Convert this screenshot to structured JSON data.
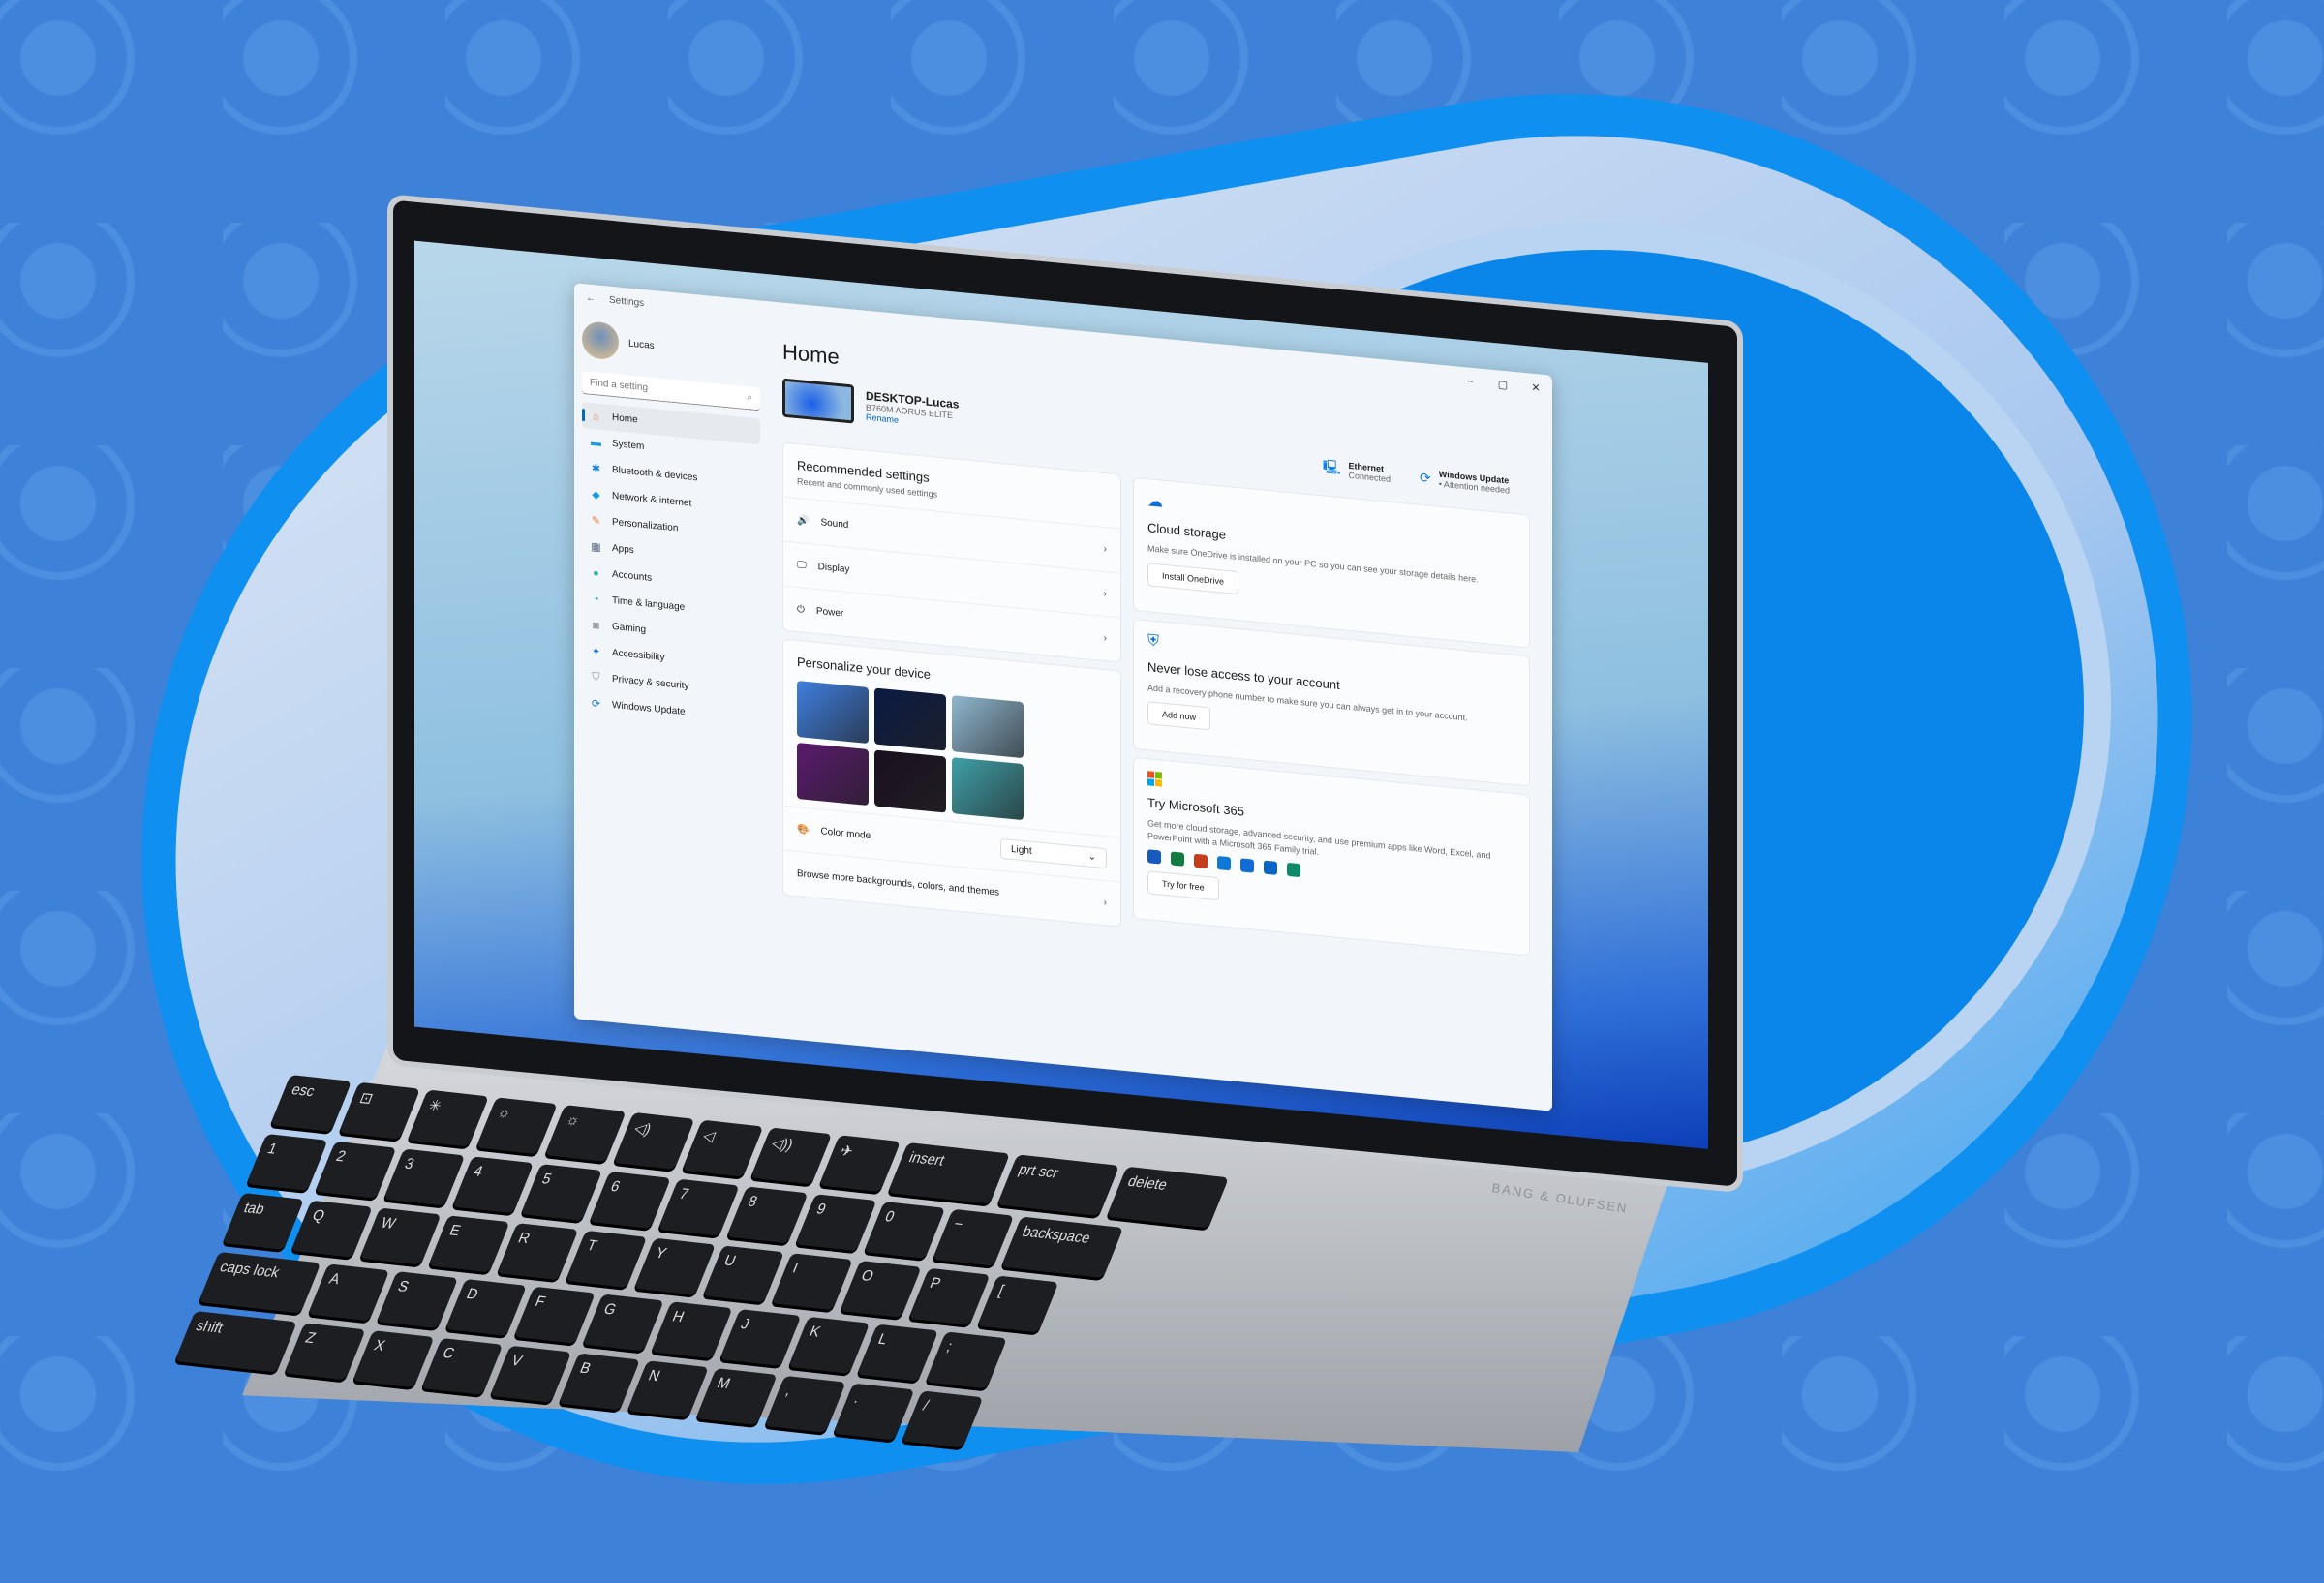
{
  "window": {
    "title": "Settings",
    "back_icon": "arrow-left",
    "controls": [
      "–",
      "▢",
      "✕"
    ]
  },
  "sidebar": {
    "user": "Lucas",
    "search_placeholder": "Find a setting",
    "items": [
      {
        "label": "Home",
        "icon": "⌂",
        "color": "#e8833a",
        "selected": true
      },
      {
        "label": "System",
        "icon": "▬",
        "color": "#1a9be0"
      },
      {
        "label": "Bluetooth & devices",
        "icon": "✱",
        "color": "#0f7fe0"
      },
      {
        "label": "Network & internet",
        "icon": "◆",
        "color": "#1a9be0"
      },
      {
        "label": "Personalization",
        "icon": "✎",
        "color": "#e8833a"
      },
      {
        "label": "Apps",
        "icon": "▦",
        "color": "#5a6b85"
      },
      {
        "label": "Accounts",
        "icon": "●",
        "color": "#27b39b"
      },
      {
        "label": "Time & language",
        "icon": "◔",
        "color": "#1a9be0"
      },
      {
        "label": "Gaming",
        "icon": "◙",
        "color": "#8a8f99"
      },
      {
        "label": "Accessibility",
        "icon": "✦",
        "color": "#1a6fd0"
      },
      {
        "label": "Privacy & security",
        "icon": "⛉",
        "color": "#8a8f99"
      },
      {
        "label": "Windows Update",
        "icon": "⟳",
        "color": "#0f7fe0"
      }
    ]
  },
  "main": {
    "title": "Home",
    "device": {
      "name": "DESKTOP-Lucas",
      "model": "B760M AORUS ELITE",
      "rename": "Rename"
    },
    "status": [
      {
        "title": "Ethernet",
        "sub": "Connected",
        "icon": "monitor-network"
      },
      {
        "title": "Windows Update",
        "sub": "• Attention needed",
        "icon": "sync"
      }
    ],
    "recommended": {
      "title": "Recommended settings",
      "subtitle": "Recent and commonly used settings",
      "items": [
        {
          "label": "Sound",
          "icon": "🔊"
        },
        {
          "label": "Display",
          "icon": "🖵"
        },
        {
          "label": "Power",
          "icon": "⏻"
        }
      ]
    },
    "personalize": {
      "title": "Personalize your device",
      "color_mode_label": "Color mode",
      "color_mode_value": "Light",
      "browse": "Browse more backgrounds, colors, and themes",
      "themes": [
        "#3f7fe0",
        "#0b1a44",
        "#8fb7d0",
        "#5a1a6e",
        "#1a1020",
        "#3fa0a8"
      ]
    },
    "cloud": {
      "title": "Cloud storage",
      "text": "Make sure OneDrive is installed on your PC so you can see your storage details here.",
      "button": "Install OneDrive"
    },
    "account": {
      "title": "Never lose access to your account",
      "text": "Add a recovery phone number to make sure you can always get in to your account.",
      "button": "Add now"
    },
    "m365": {
      "title": "Try Microsoft 365",
      "text": "Get more cloud storage, advanced security, and use premium apps like Word, Excel, and PowerPoint with a Microsoft 365 Family trial.",
      "button": "Try for free",
      "apps": [
        "#185abd",
        "#107c41",
        "#c43e1c",
        "#0f78d4",
        "#0f6cd8",
        "#0a64c4",
        "#0e8a6a"
      ]
    }
  },
  "keyboard": {
    "brand": "BANG & OLUFSEN",
    "rows": [
      [
        "esc",
        "⊡",
        "✳",
        "☼",
        "☼",
        "◁)",
        "◁",
        "◁))",
        "✈",
        "insert",
        "prt scr",
        "delete"
      ],
      [
        "1",
        "2",
        "3",
        "4",
        "5",
        "6",
        "7",
        "8",
        "9",
        "0",
        "−",
        "backspace"
      ],
      [
        "tab",
        "Q",
        "W",
        "E",
        "R",
        "T",
        "Y",
        "U",
        "I",
        "O",
        "P",
        "["
      ],
      [
        "caps lock",
        "A",
        "S",
        "D",
        "F",
        "G",
        "H",
        "J",
        "K",
        "L",
        ";"
      ],
      [
        "shift",
        "Z",
        "X",
        "C",
        "V",
        "B",
        "N",
        "M",
        ",",
        ".",
        "/"
      ]
    ]
  }
}
